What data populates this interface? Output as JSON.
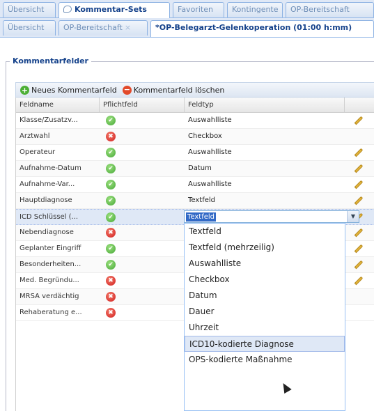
{
  "tabs_top": [
    {
      "label": "Übersicht"
    },
    {
      "label": "Kommentar-Sets",
      "active": true
    },
    {
      "label": "Favoriten"
    },
    {
      "label": "Kontingente"
    },
    {
      "label": "OP-Bereitschaft"
    }
  ],
  "tabs_second": [
    {
      "label": "Übersicht"
    },
    {
      "label": "OP-Bereitschaft",
      "close": "×"
    },
    {
      "label": "*OP-Belegarzt-Gelenkoperation (01:00 h:mm)",
      "active": true
    }
  ],
  "fieldset": {
    "legend": "Kommentarfelder"
  },
  "toolbar": {
    "add_label": "Neues Kommentarfeld",
    "delete_label": "Kommentarfeld löschen"
  },
  "grid": {
    "columns": [
      "Feldname",
      "Pflichtfeld",
      "Feldtyp"
    ],
    "rows": [
      {
        "name": "Klasse/Zusatzv...",
        "required": true,
        "type": "Auswahlliste",
        "edit": true
      },
      {
        "name": "Arztwahl",
        "required": false,
        "type": "Checkbox",
        "edit": false
      },
      {
        "name": "Operateur",
        "required": true,
        "type": "Auswahlliste",
        "edit": true
      },
      {
        "name": "Aufnahme-Datum",
        "required": true,
        "type": "Datum",
        "edit": true
      },
      {
        "name": "Aufnahme-Var...",
        "required": true,
        "type": "Auswahlliste",
        "edit": true
      },
      {
        "name": "Hauptdiagnose",
        "required": true,
        "type": "Textfeld",
        "edit": true
      },
      {
        "name": "ICD Schlüssel (...",
        "required": true,
        "type": "",
        "edit": true,
        "selected": true
      },
      {
        "name": "Nebendiagnose",
        "required": false,
        "type": "",
        "edit": true
      },
      {
        "name": "Geplanter Eingriff",
        "required": true,
        "type": "",
        "edit": true
      },
      {
        "name": "Besonderheiten...",
        "required": true,
        "type": "",
        "edit": true
      },
      {
        "name": "Med. Begründu...",
        "required": false,
        "type": "",
        "edit": true
      },
      {
        "name": "MRSA verdächtig",
        "required": false,
        "type": "",
        "edit": false
      },
      {
        "name": "Rehaberatung e...",
        "required": false,
        "type": "",
        "edit": false
      }
    ]
  },
  "combo": {
    "value": "Textfeld",
    "trigger": "▼"
  },
  "dropdown": {
    "options": [
      "Textfeld",
      "Textfeld (mehrzeilig)",
      "Auswahlliste",
      "Checkbox",
      "Datum",
      "Dauer",
      "Uhrzeit",
      "ICD10-kodierte Diagnose",
      "OPS-kodierte Maßnahme"
    ],
    "hover_index": 7
  },
  "icons": {
    "ok": "✔",
    "no": "✖"
  }
}
